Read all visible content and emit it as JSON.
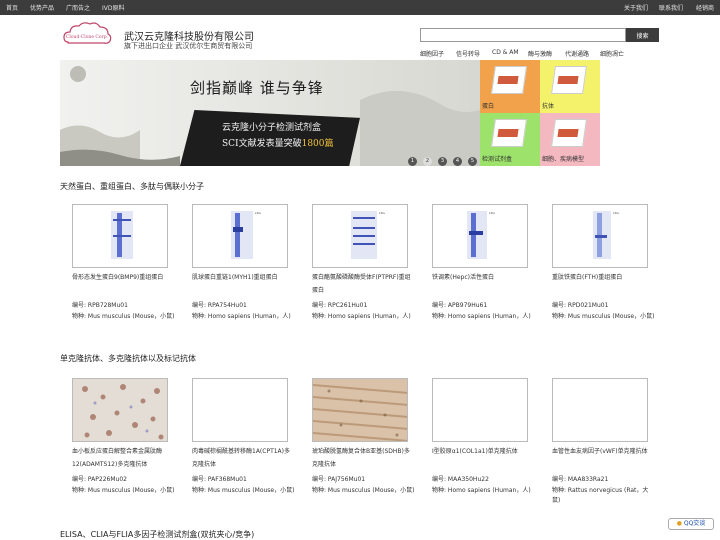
{
  "topbar": {
    "left": [
      "首页",
      "优势产品",
      "广而告之",
      "IVD原料"
    ],
    "right": [
      "关于我们",
      "联系我们",
      "经销商"
    ]
  },
  "header": {
    "logo_text": "Cloud-Clone Corp.",
    "company_name": "武汉云克隆科技股份有限公司",
    "company_sub": "旗下进出口企业 武汉优尔生商贸有限公司",
    "search_placeholder": "",
    "search_button": "搜索",
    "categories": [
      "细胞因子",
      "信号转导",
      "CD & AM",
      "酶与激酶",
      "代谢通路",
      "细胞凋亡"
    ]
  },
  "banner": {
    "title": "剑指巅峰 谁与争锋",
    "line1": "云克隆小分子检测试剂盒",
    "line2a": "SCI文献发表量突破",
    "line2b": "1800篇",
    "dots": [
      "1",
      "2",
      "3",
      "4",
      "5"
    ],
    "active_dot": 1
  },
  "tiles": [
    {
      "label": "蛋白",
      "color": "#f2a24a"
    },
    {
      "label": "抗体",
      "color": "#f4f26a"
    },
    {
      "label": "检测试剂盒",
      "color": "#9de26b"
    },
    {
      "label": "细胞、疾病模型",
      "color": "#f4b8c0"
    }
  ],
  "sections": {
    "proteins_title": "天然蛋白、重组蛋白、多肽与偶联小分子",
    "antibodies_title": "单克隆抗体、多克隆抗体以及标记抗体",
    "kits_title": "ELISA、CLIA与FLIA多因子检测试剂盒(双抗夹心/竞争)"
  },
  "proteins": [
    {
      "name": "骨形态发生蛋白9(BMP9)重组蛋白",
      "code": "编号: RPB728Mu01",
      "species": "物种: Mus musculus (Mouse，小鼠)"
    },
    {
      "name": "肌球蛋白重链1(MYH1)重组蛋白",
      "code": "编号: RPA754Hu01",
      "species": "物种: Homo sapiens (Human，人)"
    },
    {
      "name": "蛋白酪氨酸磷酸酶受体F(PTPRF)重组蛋白",
      "code": "编号: RPC261Hu01",
      "species": "物种: Homo sapiens (Human，人)"
    },
    {
      "name": "铁调素(Hepc)活性蛋白",
      "code": "编号: APB979Hu61",
      "species": "物种: Homo sapiens (Human，人)"
    },
    {
      "name": "重肽铁蛋白(FTH)重组蛋白",
      "code": "编号: RPD021Mu01",
      "species": "物种: Mus musculus (Mouse，小鼠)"
    }
  ],
  "antibodies": [
    {
      "name": "血小板反应蛋白解整合素金属肽酶12(ADAMTS12)多克隆抗体",
      "code": "编号: PAP226Mu02",
      "species": "物种: Mus musculus (Mouse，小鼠)"
    },
    {
      "name": "肉毒碱棕榈酰基转移酶1A(CPT1A)多克隆抗体",
      "code": "编号: PAF368Mu01",
      "species": "物种: Mus musculus (Mouse，小鼠)"
    },
    {
      "name": "琥珀酸脱氢酶复合体B亚基(SDHB)多克隆抗体",
      "code": "编号: PAJ756Mu01",
      "species": "物种: Mus musculus (Mouse，小鼠)"
    },
    {
      "name": "Ⅰ型胶原α1(COL1a1)单克隆抗体",
      "code": "编号: MAA350Hu22",
      "species": "物种: Homo sapiens (Human，人)"
    },
    {
      "name": "血管性血友病因子(vWF)单克隆抗体",
      "code": "编号: MAA833Ra21",
      "species": "物种: Rattus norvegicus (Rat，大鼠)"
    }
  ],
  "gel_markers": [
    "kDa",
    "70",
    "44",
    "33",
    "26",
    "22",
    "18",
    "14",
    "10"
  ],
  "qq_button": "QQ交谈"
}
